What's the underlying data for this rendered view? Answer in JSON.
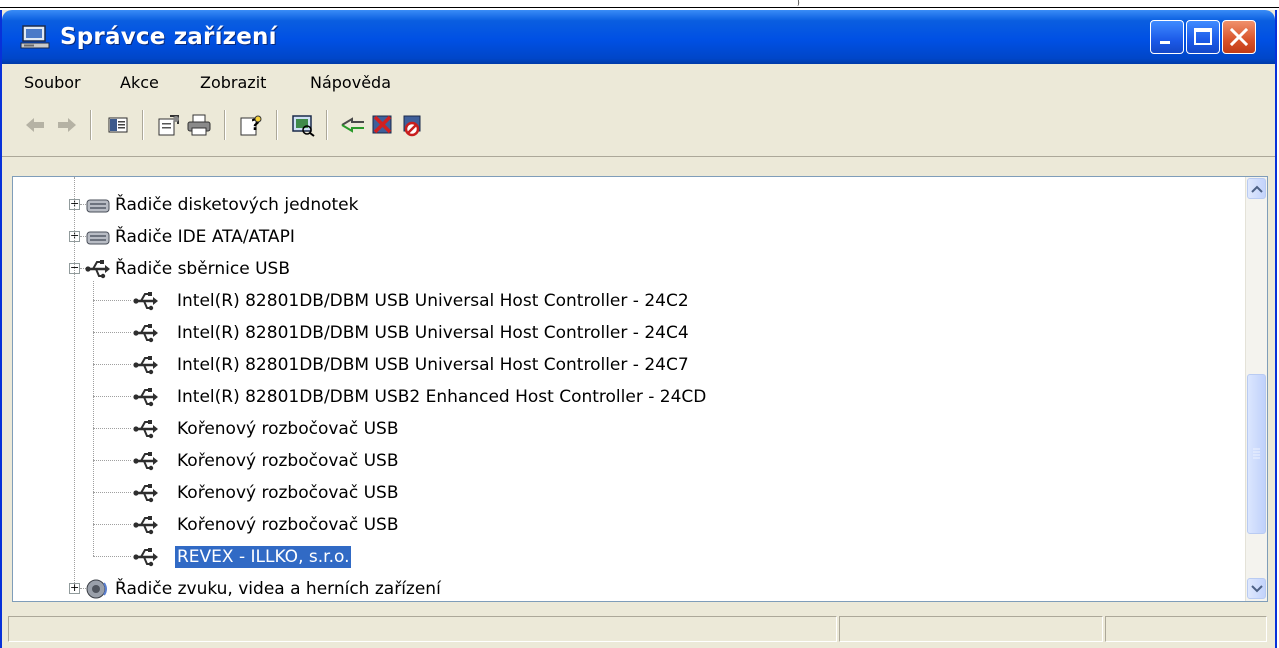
{
  "window": {
    "title": "Správce zařízení"
  },
  "menu": {
    "items": [
      "Soubor",
      "Akce",
      "Zobrazit",
      "Nápověda"
    ]
  },
  "toolbar": {
    "buttons": [
      "back-icon",
      "forward-icon",
      "show-hide-tree-icon",
      "properties-icon",
      "print-icon",
      "help-icon",
      "scan-hardware-icon",
      "update-driver-icon",
      "uninstall-icon",
      "disable-icon"
    ]
  },
  "tree": {
    "rows": [
      {
        "label": "Řadiče disketových jednotek",
        "level": 0,
        "expander": "+",
        "icon": "controller-icon",
        "selected": false
      },
      {
        "label": "Řadiče IDE ATA/ATAPI",
        "level": 0,
        "expander": "+",
        "icon": "controller-icon",
        "selected": false
      },
      {
        "label": "Řadiče sběrnice USB",
        "level": 0,
        "expander": "−",
        "icon": "usb-icon",
        "selected": false
      },
      {
        "label": "Intel(R) 82801DB/DBM USB Universal Host Controller - 24C2",
        "level": 1,
        "icon": "usb-icon",
        "selected": false
      },
      {
        "label": "Intel(R) 82801DB/DBM USB Universal Host Controller - 24C4",
        "level": 1,
        "icon": "usb-icon",
        "selected": false
      },
      {
        "label": "Intel(R) 82801DB/DBM USB Universal Host Controller - 24C7",
        "level": 1,
        "icon": "usb-icon",
        "selected": false
      },
      {
        "label": "Intel(R) 82801DB/DBM USB2 Enhanced Host Controller - 24CD",
        "level": 1,
        "icon": "usb-icon",
        "selected": false
      },
      {
        "label": "Kořenový rozbočovač USB",
        "level": 1,
        "icon": "usb-icon",
        "selected": false
      },
      {
        "label": "Kořenový rozbočovač USB",
        "level": 1,
        "icon": "usb-icon",
        "selected": false
      },
      {
        "label": "Kořenový rozbočovač USB",
        "level": 1,
        "icon": "usb-icon",
        "selected": false
      },
      {
        "label": "Kořenový rozbočovač USB",
        "level": 1,
        "icon": "usb-icon",
        "selected": false
      },
      {
        "label": "REVEX - ILLKO, s.r.o.",
        "level": 1,
        "icon": "usb-icon",
        "selected": true
      },
      {
        "label": "Řadiče zvuku, videa a herních zařízení",
        "level": 0,
        "expander": "+",
        "icon": "speaker-icon",
        "selected": false
      }
    ]
  },
  "colors": {
    "titlebar": "#0050e4",
    "selection": "#316ac5",
    "chrome": "#ece9d8"
  }
}
